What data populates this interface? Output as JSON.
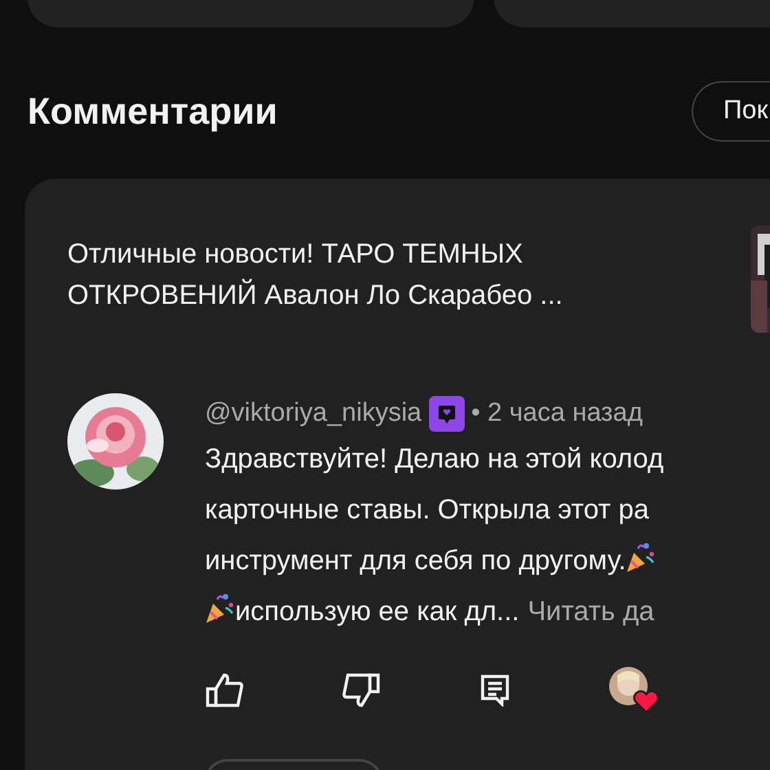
{
  "heading": "Комментарии",
  "sort_button": {
    "label": "Пок"
  },
  "video": {
    "title": [
      "Отличные новости! ТАРО ТЕМНЫХ",
      "ОТКРОВЕНИЙ Авалон Ло Скарабео ..."
    ]
  },
  "comment": {
    "author": "@viktoriya_nikysia",
    "member_badge": true,
    "time": "• 2 часа назад",
    "lines": [
      {
        "text": "Здравствуйте! Делаю на этой колод",
        "emoji_before": false,
        "emoji_after": false
      },
      {
        "text": "карточные ставы. Открыла этот ра",
        "emoji_before": false,
        "emoji_after": false
      },
      {
        "text": "инструмент для себя по другому.",
        "emoji_before": false,
        "emoji_after": true
      },
      {
        "text": "использую ее как дл...",
        "emoji_before": true,
        "emoji_after": false
      }
    ],
    "read_more": "Читать да",
    "creator_heart": true
  }
}
